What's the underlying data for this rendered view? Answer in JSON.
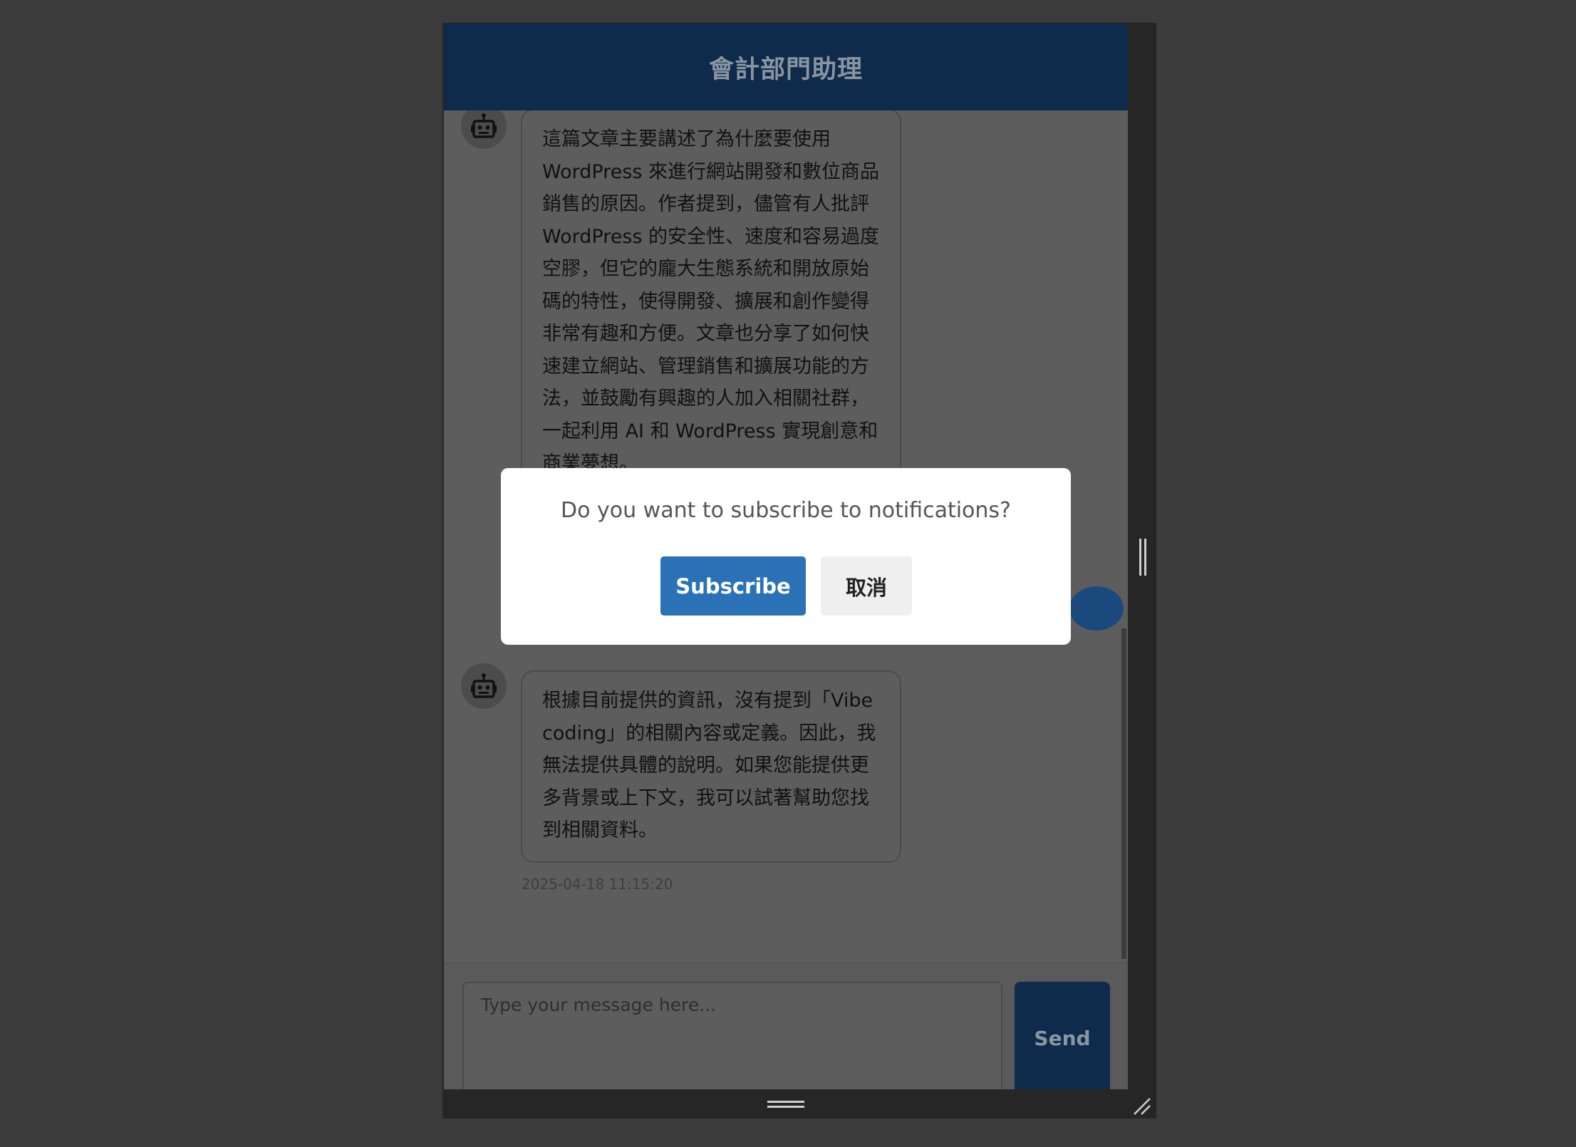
{
  "header": {
    "title": "會計部門助理"
  },
  "messages": [
    {
      "sender": "bot",
      "icon": "robot-icon",
      "text": "這篇文章主要講述了為什麼要使用 WordPress 來進行網站開發和數位商品銷售的原因。作者提到，儘管有人批評 WordPress 的安全性、速度和容易過度空膠，但它的龐大生態系統和開放原始碼的特性，使得開發、擴展和創作變得非常有趣和方便。文章也分享了如何快速建立網站、管理銷售和擴展功能的方法，並鼓勵有興趣的人加入相關社群，一起利用 AI 和 WordPress 實現創意和商業夢想。"
    },
    {
      "sender": "bot",
      "icon": "robot-icon",
      "text": "根據目前提供的資訊，沒有提到「Vibe coding」的相關內容或定義。因此，我無法提供具體的說明。如果您能提供更多背景或上下文，我可以試著幫助您找到相關資料。",
      "timestamp": "2025-04-18 11:15:20"
    }
  ],
  "input": {
    "placeholder": "Type your message here...",
    "value": ""
  },
  "send": {
    "label": "Send"
  },
  "modal": {
    "text": "Do you want to subscribe to notifications?",
    "subscribe_label": "Subscribe",
    "cancel_label": "取消"
  },
  "colors": {
    "header_bg": "#0f2b4b",
    "accent": "#2a72b5",
    "overlay_page": "#3b3b3b"
  }
}
